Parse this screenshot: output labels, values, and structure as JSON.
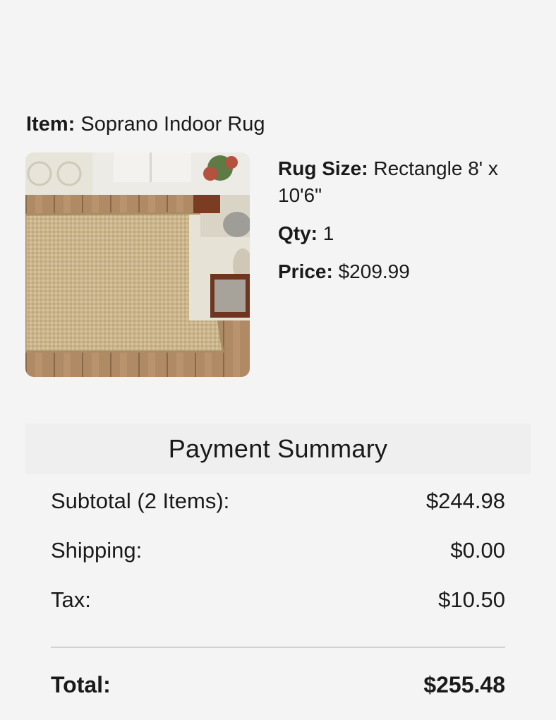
{
  "item": {
    "label": "Item:",
    "value": "Soprano Indoor Rug"
  },
  "details": {
    "rug_size_label": "Rug Size:",
    "rug_size_value": "Rectangle 8' x 10'6\"",
    "qty_label": "Qty:",
    "qty_value": "1",
    "price_label": "Price:",
    "price_value": "$209.99"
  },
  "summary": {
    "title": "Payment Summary",
    "rows": [
      {
        "label": "Subtotal (2 Items):",
        "value": "$244.98"
      },
      {
        "label": "Shipping:",
        "value": "$0.00"
      },
      {
        "label": "Tax:",
        "value": "$10.50"
      }
    ],
    "total": {
      "label": "Total:",
      "value": "$255.48"
    }
  }
}
